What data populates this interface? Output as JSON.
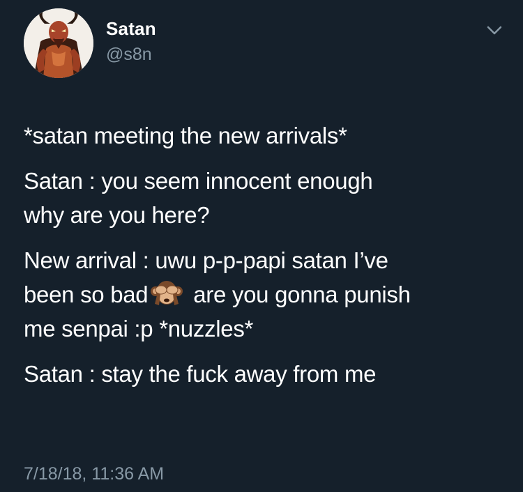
{
  "user": {
    "display_name": "Satan",
    "handle": "@s8n"
  },
  "icons": {
    "avatar": "demon-avatar",
    "menu": "chevron-down-icon",
    "emoji": "see-no-evil-monkey-emoji"
  },
  "tweet": {
    "line1": "*satan meeting the new arrivals*",
    "line2": "Satan : you seem innocent enough\nwhy are you here?",
    "line3_part1": "New arrival : uwu p-p-papi satan I’ve\nbeen so bad",
    "line3_part2": " are you gonna punish\nme senpai :p *nuzzles*",
    "line4": "Satan : stay the fuck away from me"
  },
  "timestamp": "7/18/18, 11:36 AM",
  "colors": {
    "background": "#15202b",
    "text": "#ffffff",
    "secondary": "#8899a6"
  }
}
